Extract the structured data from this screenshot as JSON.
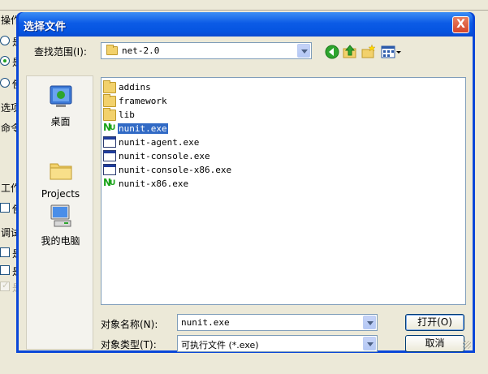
{
  "background_window": {
    "labels": [
      "操作",
      "是",
      "是",
      "使",
      "选项",
      "命令",
      "工作",
      "使",
      "调试",
      "是",
      "是",
      "是"
    ]
  },
  "dialog": {
    "title": "选择文件",
    "close_label": "X",
    "lookin_label": "查找范围(I):",
    "lookin_value": "net-2.0",
    "places": [
      {
        "label": "桌面",
        "icon": "desktop-icon"
      },
      {
        "label": "Projects",
        "icon": "folder-icon"
      },
      {
        "label": "我的电脑",
        "icon": "my-computer-icon"
      }
    ],
    "files": [
      {
        "name": "addins",
        "type": "folder"
      },
      {
        "name": "framework",
        "type": "folder"
      },
      {
        "name": "lib",
        "type": "folder"
      },
      {
        "name": "nunit.exe",
        "type": "nunit",
        "selected": true
      },
      {
        "name": "nunit-agent.exe",
        "type": "exe"
      },
      {
        "name": "nunit-console.exe",
        "type": "exe"
      },
      {
        "name": "nunit-console-x86.exe",
        "type": "exe"
      },
      {
        "name": "nunit-x86.exe",
        "type": "nunit"
      }
    ],
    "filename_label": "对象名称(N):",
    "filename_value": "nunit.exe",
    "filetype_label": "对象类型(T):",
    "filetype_value": "可执行文件 (*.exe)",
    "open_button": "打开(O)",
    "cancel_button": "取消"
  },
  "colors": {
    "titlebar": "#0554e0",
    "selection": "#316ac5",
    "close": "#d4452a"
  }
}
